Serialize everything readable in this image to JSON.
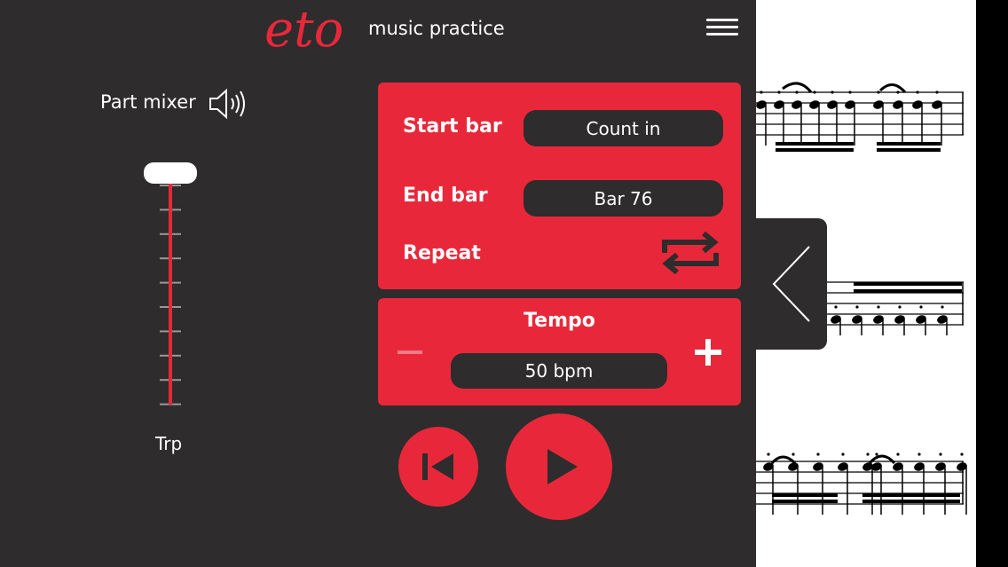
{
  "header": {
    "logo": "eto",
    "subtitle": "music practice",
    "menu_icon": "hamburger-menu-icon"
  },
  "mixer": {
    "title": "Part mixer",
    "speaker_icon": "speaker-icon",
    "channel_label": "Trp",
    "fader_level": 1.0
  },
  "range": {
    "start_label": "Start bar",
    "start_value": "Count in",
    "end_label": "End bar",
    "end_value": "Bar 76",
    "repeat_label": "Repeat",
    "repeat_icon": "repeat-icon"
  },
  "tempo": {
    "title": "Tempo",
    "value": "50 bpm",
    "minus_icon": "minus-icon",
    "plus_icon": "plus-icon"
  },
  "transport": {
    "rewind_icon": "skip-to-start-icon",
    "play_icon": "play-icon"
  },
  "side_tab": {
    "icon": "chevron-left-icon"
  },
  "colors": {
    "background": "#2e2c2d",
    "accent": "#e8283a",
    "pill": "#2e2c2d",
    "text": "#ffffff"
  }
}
